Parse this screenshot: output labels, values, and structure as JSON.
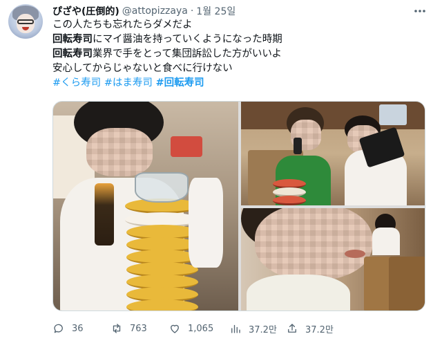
{
  "author": {
    "name": "ぴざや(圧倒的)",
    "handle": "@attopizzaya",
    "separator": "·",
    "date": "1월 25일"
  },
  "more_icon": "more-horizontal-icon",
  "tweet": {
    "line1": "この人たちも忘れたらダメだよ",
    "line2_bold": "回転寿司",
    "line2_rest": "にマイ醤油を持っていくようになった時期",
    "line3_bold": "回転寿司",
    "line3_rest": "業界で手をとって集団訴訟した方がいいよ",
    "line4": "安心してからじゃないと食べに行けない",
    "hashtags": [
      "#くら寿司",
      "#はま寿司",
      "#回転寿司"
    ]
  },
  "media": {
    "photo_count": 3
  },
  "actions": {
    "reply": {
      "icon": "reply-icon",
      "count": "36"
    },
    "retweet": {
      "icon": "retweet-icon",
      "count": "763"
    },
    "like": {
      "icon": "heart-icon",
      "count": "1,065"
    },
    "views": {
      "icon": "views-icon",
      "count": "37.2만"
    },
    "share": {
      "icon": "share-icon",
      "count": "37.2만"
    }
  },
  "colors": {
    "accent": "#1d9bf0",
    "secondary_text": "#536471",
    "primary_text": "#0f1419"
  }
}
